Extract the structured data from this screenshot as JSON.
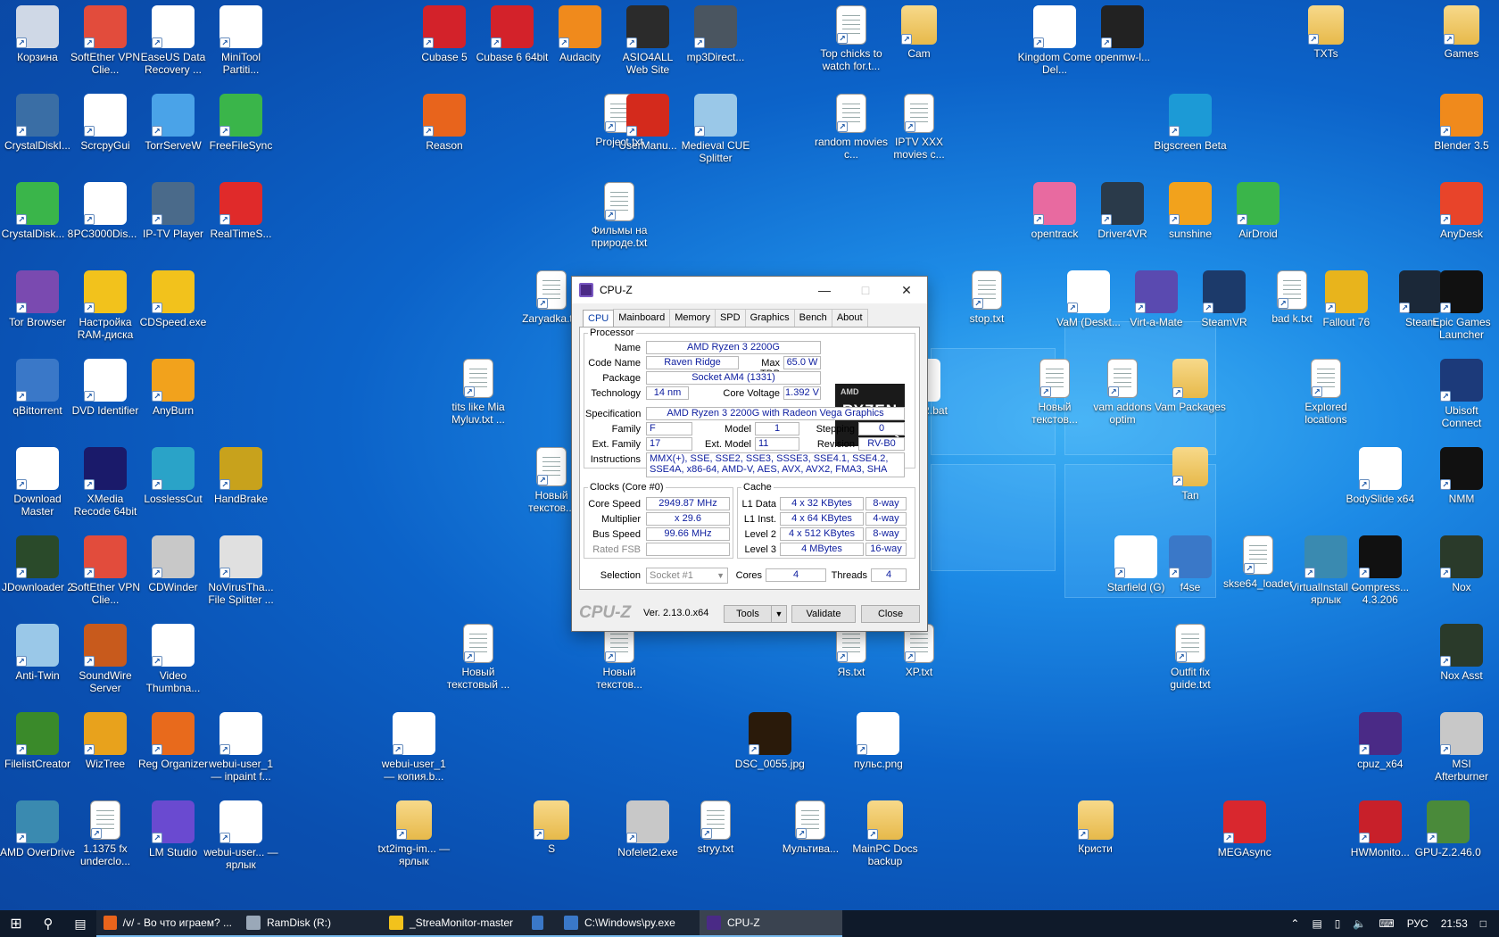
{
  "desktop": {
    "icons": [
      {
        "label": "Корзина",
        "type": "app",
        "color": "#cfd8e6"
      },
      {
        "label": "SoftEther VPN Clie...",
        "type": "app",
        "color": "#e24c3c"
      },
      {
        "label": "EaseUS Data Recovery ...",
        "type": "app",
        "color": "#ffffff"
      },
      {
        "label": "MiniTool Partiti...",
        "type": "app",
        "color": "#ffffff"
      },
      {
        "label": "Cubase 5",
        "type": "app",
        "color": "#d3222a"
      },
      {
        "label": "Cubase 6 64bit",
        "type": "app",
        "color": "#d3222a"
      },
      {
        "label": "Audacity",
        "type": "app",
        "color": "#f08a1c"
      },
      {
        "label": "ASIO4ALL Web Site",
        "type": "app",
        "color": "#2b2b2b"
      },
      {
        "label": "mp3Direct...",
        "type": "app",
        "color": "#4a5560"
      },
      {
        "label": "Top chicks to watch for.t...",
        "type": "doc"
      },
      {
        "label": "Cam",
        "type": "folder"
      },
      {
        "label": "Kingdom Come Del...",
        "type": "app",
        "color": "#ffffff"
      },
      {
        "label": "openmw-l...",
        "type": "app",
        "color": "#222222"
      },
      {
        "label": "TXTs",
        "type": "folder"
      },
      {
        "label": "Games",
        "type": "folder"
      },
      {
        "label": "CrystalDiskI...",
        "type": "app",
        "color": "#3a6ea5"
      },
      {
        "label": "ScrcpyGui",
        "type": "app",
        "color": "#ffffff"
      },
      {
        "label": "TorrServeW",
        "type": "app",
        "color": "#4aa3e8"
      },
      {
        "label": "FreeFileSync",
        "type": "app",
        "color": "#3ab54a"
      },
      {
        "label": "Reason",
        "type": "app",
        "color": "#e8641c"
      },
      {
        "label": "Project.txt",
        "type": "doc"
      },
      {
        "label": "UserManu...",
        "type": "app",
        "color": "#d42a1c"
      },
      {
        "label": "Medieval CUE Splitter",
        "type": "app",
        "color": "#9ac8e8"
      },
      {
        "label": "random movies c...",
        "type": "doc"
      },
      {
        "label": "IPTV XXX movies c...",
        "type": "doc"
      },
      {
        "label": "Bigscreen Beta",
        "type": "app",
        "color": "#1c9ad6"
      },
      {
        "label": "Blender 3.5",
        "type": "app",
        "color": "#f08a1c"
      },
      {
        "label": "CrystalDisk... 8",
        "type": "app",
        "color": "#3ab54a"
      },
      {
        "label": "PC3000Dis...",
        "type": "app",
        "color": "#ffffff"
      },
      {
        "label": "IP-TV Player",
        "type": "app",
        "color": "#4a6a8a"
      },
      {
        "label": "RealTimeS...",
        "type": "app",
        "color": "#e02a2a"
      },
      {
        "label": "Фильмы на природе.txt",
        "type": "doc"
      },
      {
        "label": "opentrack",
        "type": "app",
        "color": "#e86aa0"
      },
      {
        "label": "Driver4VR",
        "type": "app",
        "color": "#2a3a4a"
      },
      {
        "label": "sunshine",
        "type": "app",
        "color": "#f2a21c"
      },
      {
        "label": "AirDroid",
        "type": "app",
        "color": "#3ab54a"
      },
      {
        "label": "AnyDesk",
        "type": "app",
        "color": "#e8442a"
      },
      {
        "label": "Tor Browser",
        "type": "app",
        "color": "#7a4ab0"
      },
      {
        "label": "Настройка RAM-диска",
        "type": "app",
        "color": "#f2c21c"
      },
      {
        "label": "CDSpeed.exe",
        "type": "app",
        "color": "#f2c21c"
      },
      {
        "label": "Zaryadka.txt",
        "type": "doc"
      },
      {
        "label": "stop.txt",
        "type": "doc"
      },
      {
        "label": "VaM (Deskt...",
        "type": "app",
        "color": "#ffffff"
      },
      {
        "label": "Virt-a-Mate",
        "type": "app",
        "color": "#5a4ab0"
      },
      {
        "label": "SteamVR",
        "type": "app",
        "color": "#1c3a6a"
      },
      {
        "label": "bad k.txt",
        "type": "doc"
      },
      {
        "label": "Fallout 76",
        "type": "app",
        "color": "#e8b41c"
      },
      {
        "label": "Steam",
        "type": "app",
        "color": "#1b2838"
      },
      {
        "label": "Epic Games Launcher",
        "type": "app",
        "color": "#111111"
      },
      {
        "label": "qBittorrent",
        "type": "app",
        "color": "#3a78c8"
      },
      {
        "label": "DVD Identifier",
        "type": "app",
        "color": "#ffffff"
      },
      {
        "label": "AnyBurn",
        "type": "app",
        "color": "#f2a21c"
      },
      {
        "label": "tits like Mia Myluv.txt ...",
        "type": "doc"
      },
      {
        "label": "VaM VR.bat",
        "type": "app",
        "color": "#ffffff"
      },
      {
        "label": "Новый текстов...",
        "type": "doc"
      },
      {
        "label": "vam addons optim",
        "type": "doc"
      },
      {
        "label": "Vam Packages",
        "type": "folder"
      },
      {
        "label": "Explored locations",
        "type": "doc"
      },
      {
        "label": "Ubisoft Connect",
        "type": "app",
        "color": "#1c3a7a"
      },
      {
        "label": "Download Master",
        "type": "app",
        "color": "#ffffff"
      },
      {
        "label": "XMedia Recode 64bit",
        "type": "app",
        "color": "#1a1a6a"
      },
      {
        "label": "LosslessCut",
        "type": "app",
        "color": "#2aa3c8"
      },
      {
        "label": "HandBrake",
        "type": "app",
        "color": "#c8a21c"
      },
      {
        "label": "Новый текстов...",
        "type": "doc"
      },
      {
        "label": "Tan",
        "type": "folder"
      },
      {
        "label": "BodySlide x64",
        "type": "app",
        "color": "#ffffff"
      },
      {
        "label": "NMM",
        "type": "app",
        "color": "#111111"
      },
      {
        "label": "JDownloader 2",
        "type": "app",
        "color": "#2a4a2a"
      },
      {
        "label": "SoftEther VPN Clie...",
        "type": "app",
        "color": "#e24c3c"
      },
      {
        "label": "CDWinder",
        "type": "app",
        "color": "#c8c8c8"
      },
      {
        "label": "NoVirusTha... File Splitter ...",
        "type": "app",
        "color": "#e0e0e0"
      },
      {
        "label": "Starfield (G)",
        "type": "app",
        "color": "#ffffff"
      },
      {
        "label": "f4se",
        "type": "app",
        "color": "#3a78c8"
      },
      {
        "label": "skse64_loader",
        "type": "doc"
      },
      {
        "label": "VirtualInstall — ярлык",
        "type": "app",
        "color": "#3a8ab0"
      },
      {
        "label": "Compress... 4.3.206",
        "type": "app",
        "color": "#111111"
      },
      {
        "label": "Nox",
        "type": "app",
        "color": "#2a3a2a"
      },
      {
        "label": "Anti-Twin",
        "type": "app",
        "color": "#9ac8e8"
      },
      {
        "label": "SoundWire Server",
        "type": "app",
        "color": "#c85a1c"
      },
      {
        "label": "Video Thumbna...",
        "type": "app",
        "color": "#ffffff"
      },
      {
        "label": "Новый текстовый ...",
        "type": "doc"
      },
      {
        "label": "Новый текстов...",
        "type": "doc"
      },
      {
        "label": "Яs.txt",
        "type": "doc"
      },
      {
        "label": "XP.txt",
        "type": "doc"
      },
      {
        "label": "Outfit fix guide.txt",
        "type": "doc"
      },
      {
        "label": "Nox Asst",
        "type": "app",
        "color": "#2a3a2a"
      },
      {
        "label": "FilelistCreator",
        "type": "app",
        "color": "#3a8a2a"
      },
      {
        "label": "WizTree",
        "type": "app",
        "color": "#e8a21c"
      },
      {
        "label": "Reg Organizer",
        "type": "app",
        "color": "#e86a1c"
      },
      {
        "label": "webui-user_1 — inpaint f...",
        "type": "app",
        "color": "#ffffff"
      },
      {
        "label": "webui-user_1 — копия.b...",
        "type": "app",
        "color": "#ffffff"
      },
      {
        "label": "DSC_0055.jpg",
        "type": "app",
        "color": "#2a1a0a"
      },
      {
        "label": "пульс.png",
        "type": "app",
        "color": "#ffffff"
      },
      {
        "label": "cpuz_x64",
        "type": "app",
        "color": "#4a2a86"
      },
      {
        "label": "MSI Afterburner",
        "type": "app",
        "color": "#c8c8c8"
      },
      {
        "label": "AMD OverDrive",
        "type": "app",
        "color": "#3a8ab0"
      },
      {
        "label": "1.1375 fx underclo...",
        "type": "doc"
      },
      {
        "label": "LM Studio",
        "type": "app",
        "color": "#6a4ad0"
      },
      {
        "label": "webui-user... — ярлык",
        "type": "app",
        "color": "#ffffff"
      },
      {
        "label": "txt2img-im... — ярлык",
        "type": "folder"
      },
      {
        "label": "S",
        "type": "folder"
      },
      {
        "label": "Nofelet2.exe",
        "type": "app",
        "color": "#c8c8c8"
      },
      {
        "label": "stryy.txt",
        "type": "doc"
      },
      {
        "label": "Мультива...",
        "type": "doc"
      },
      {
        "label": "MainPC Docs backup",
        "type": "folder"
      },
      {
        "label": "Кристи",
        "type": "folder"
      },
      {
        "label": "MEGAsync",
        "type": "app",
        "color": "#d9272e"
      },
      {
        "label": "HWMonito...",
        "type": "app",
        "color": "#c8202a"
      },
      {
        "label": "GPU-Z.2.46.0",
        "type": "app",
        "color": "#4a8a3a"
      }
    ]
  },
  "cpuz": {
    "title": "CPU-Z",
    "tabs": [
      "CPU",
      "Mainboard",
      "Memory",
      "SPD",
      "Graphics",
      "Bench",
      "About"
    ],
    "processor_legend": "Processor",
    "name_label": "Name",
    "name": "AMD Ryzen 3 2200G",
    "codename_label": "Code Name",
    "codename": "Raven Ridge",
    "maxtdp_label": "Max TDP",
    "maxtdp": "65.0 W",
    "package_label": "Package",
    "package": "Socket AM4 (1331)",
    "technology_label": "Technology",
    "technology": "14 nm",
    "corevoltage_label": "Core Voltage",
    "corevoltage": "1.392 V",
    "spec_label": "Specification",
    "spec": "AMD Ryzen 3 2200G with Radeon Vega Graphics",
    "family_label": "Family",
    "family": "F",
    "model_label": "Model",
    "model": "1",
    "stepping_label": "Stepping",
    "stepping": "0",
    "extfamily_label": "Ext. Family",
    "extfamily": "17",
    "extmodel_label": "Ext. Model",
    "extmodel": "11",
    "revision_label": "Revision",
    "revision": "RV-B0",
    "instructions_label": "Instructions",
    "instructions": "MMX(+), SSE, SSE2, SSE3, SSSE3, SSE4.1, SSE4.2, SSE4A, x86-64, AMD-V, AES, AVX, AVX2, FMA3, SHA",
    "logo_amd": "AMD",
    "logo_ryzen": "RYZEN",
    "logo_num": "3",
    "clocks_legend": "Clocks (Core #0)",
    "corespeed_label": "Core Speed",
    "corespeed": "2949.87 MHz",
    "multiplier_label": "Multiplier",
    "multiplier": "x 29.6",
    "busspeed_label": "Bus Speed",
    "busspeed": "99.66 MHz",
    "ratedfsb_label": "Rated FSB",
    "ratedfsb": "",
    "cache_legend": "Cache",
    "l1d_label": "L1 Data",
    "l1d": "4 x 32 KBytes",
    "l1d_way": "8-way",
    "l1i_label": "L1 Inst.",
    "l1i": "4 x 64 KBytes",
    "l1i_way": "4-way",
    "l2_label": "Level 2",
    "l2": "4 x 512 KBytes",
    "l2_way": "8-way",
    "l3_label": "Level 3",
    "l3": "4 MBytes",
    "l3_way": "16-way",
    "selection_label": "Selection",
    "selection": "Socket #1",
    "cores_label": "Cores",
    "cores": "4",
    "threads_label": "Threads",
    "threads": "4",
    "brand": "CPU-Z",
    "version": "Ver. 2.13.0.x64",
    "tools_btn": "Tools",
    "validate_btn": "Validate",
    "close_btn": "Close"
  },
  "taskbar": {
    "apps": [
      {
        "label": "/v/ - Во что играем? ...",
        "color": "#e8641c"
      },
      {
        "label": "RamDisk (R:)",
        "color": "#9aa8b8"
      },
      {
        "label": "_StreaMonitor-master",
        "color": "#f2c21c"
      },
      {
        "label": "",
        "color": "#3a78c8"
      },
      {
        "label": "C:\\Windows\\py.exe",
        "color": "#3a78c8"
      },
      {
        "label": "CPU-Z",
        "color": "#4a2a86"
      }
    ],
    "lang": "РУС",
    "time": "21:53"
  }
}
